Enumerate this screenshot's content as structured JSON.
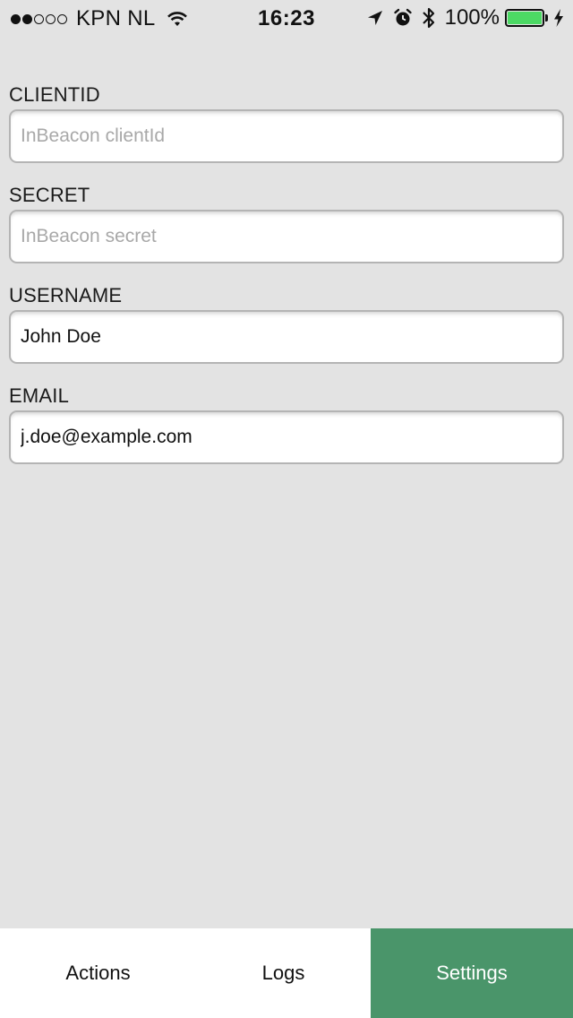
{
  "status_bar": {
    "signal_bars_filled": 2,
    "signal_bars_total": 5,
    "carrier": "KPN NL",
    "time": "16:23",
    "battery_percent": "100%",
    "battery_level": 1.0,
    "icons": [
      "wifi-icon",
      "location-arrow-icon",
      "alarm-icon",
      "bluetooth-icon",
      "battery-icon",
      "charging-bolt-icon"
    ],
    "battery_color": "#4cd964"
  },
  "form": {
    "fields": [
      {
        "label": "CLIENTID",
        "value": "",
        "placeholder": "InBeacon clientId"
      },
      {
        "label": "SECRET",
        "value": "",
        "placeholder": "InBeacon secret"
      },
      {
        "label": "USERNAME",
        "value": "John Doe",
        "placeholder": ""
      },
      {
        "label": "EMAIL",
        "value": "j.doe@example.com",
        "placeholder": ""
      }
    ]
  },
  "tab_bar": {
    "tabs": [
      {
        "label": "Actions",
        "active": false
      },
      {
        "label": "Logs",
        "active": false
      },
      {
        "label": "Settings",
        "active": true
      }
    ],
    "active_color": "#4a956a"
  }
}
